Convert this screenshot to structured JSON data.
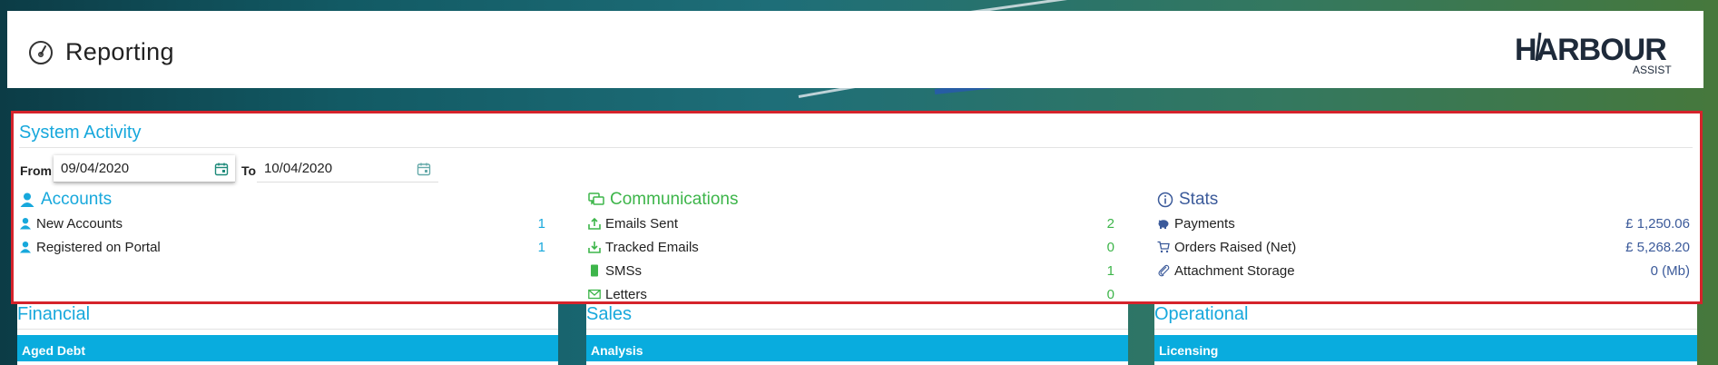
{
  "header": {
    "title": "Reporting",
    "logo_text": "HARBOUR",
    "logo_sub": "ASSIST"
  },
  "system_activity": {
    "title": "System Activity",
    "from_label": "From",
    "from_value": "09/04/2020",
    "to_label": "To",
    "to_value": "10/04/2020"
  },
  "accounts": {
    "title": "Accounts",
    "rows": [
      {
        "label": "New Accounts",
        "value": "1"
      },
      {
        "label": "Registered on Portal",
        "value": "1"
      }
    ]
  },
  "communications": {
    "title": "Communications",
    "rows": [
      {
        "label": "Emails Sent",
        "value": "2"
      },
      {
        "label": "Tracked Emails",
        "value": "0"
      },
      {
        "label": "SMSs",
        "value": "1"
      },
      {
        "label": "Letters",
        "value": "0"
      }
    ]
  },
  "stats": {
    "title": "Stats",
    "rows": [
      {
        "label": "Payments",
        "value": "£ 1,250.06"
      },
      {
        "label": "Orders Raised (Net)",
        "value": "£ 5,268.20"
      },
      {
        "label": "Attachment Storage",
        "value": "0 (Mb)"
      }
    ]
  },
  "lower": {
    "financial": {
      "title": "Financial",
      "bar": "Aged Debt"
    },
    "sales": {
      "title": "Sales",
      "bar": "Analysis"
    },
    "operational": {
      "title": "Operational",
      "bar": "Licensing"
    }
  },
  "colors": {
    "accent_blue": "#17a8dc",
    "green": "#3db54a",
    "navy": "#3b5a9a",
    "highlight_border": "#d5232b"
  }
}
